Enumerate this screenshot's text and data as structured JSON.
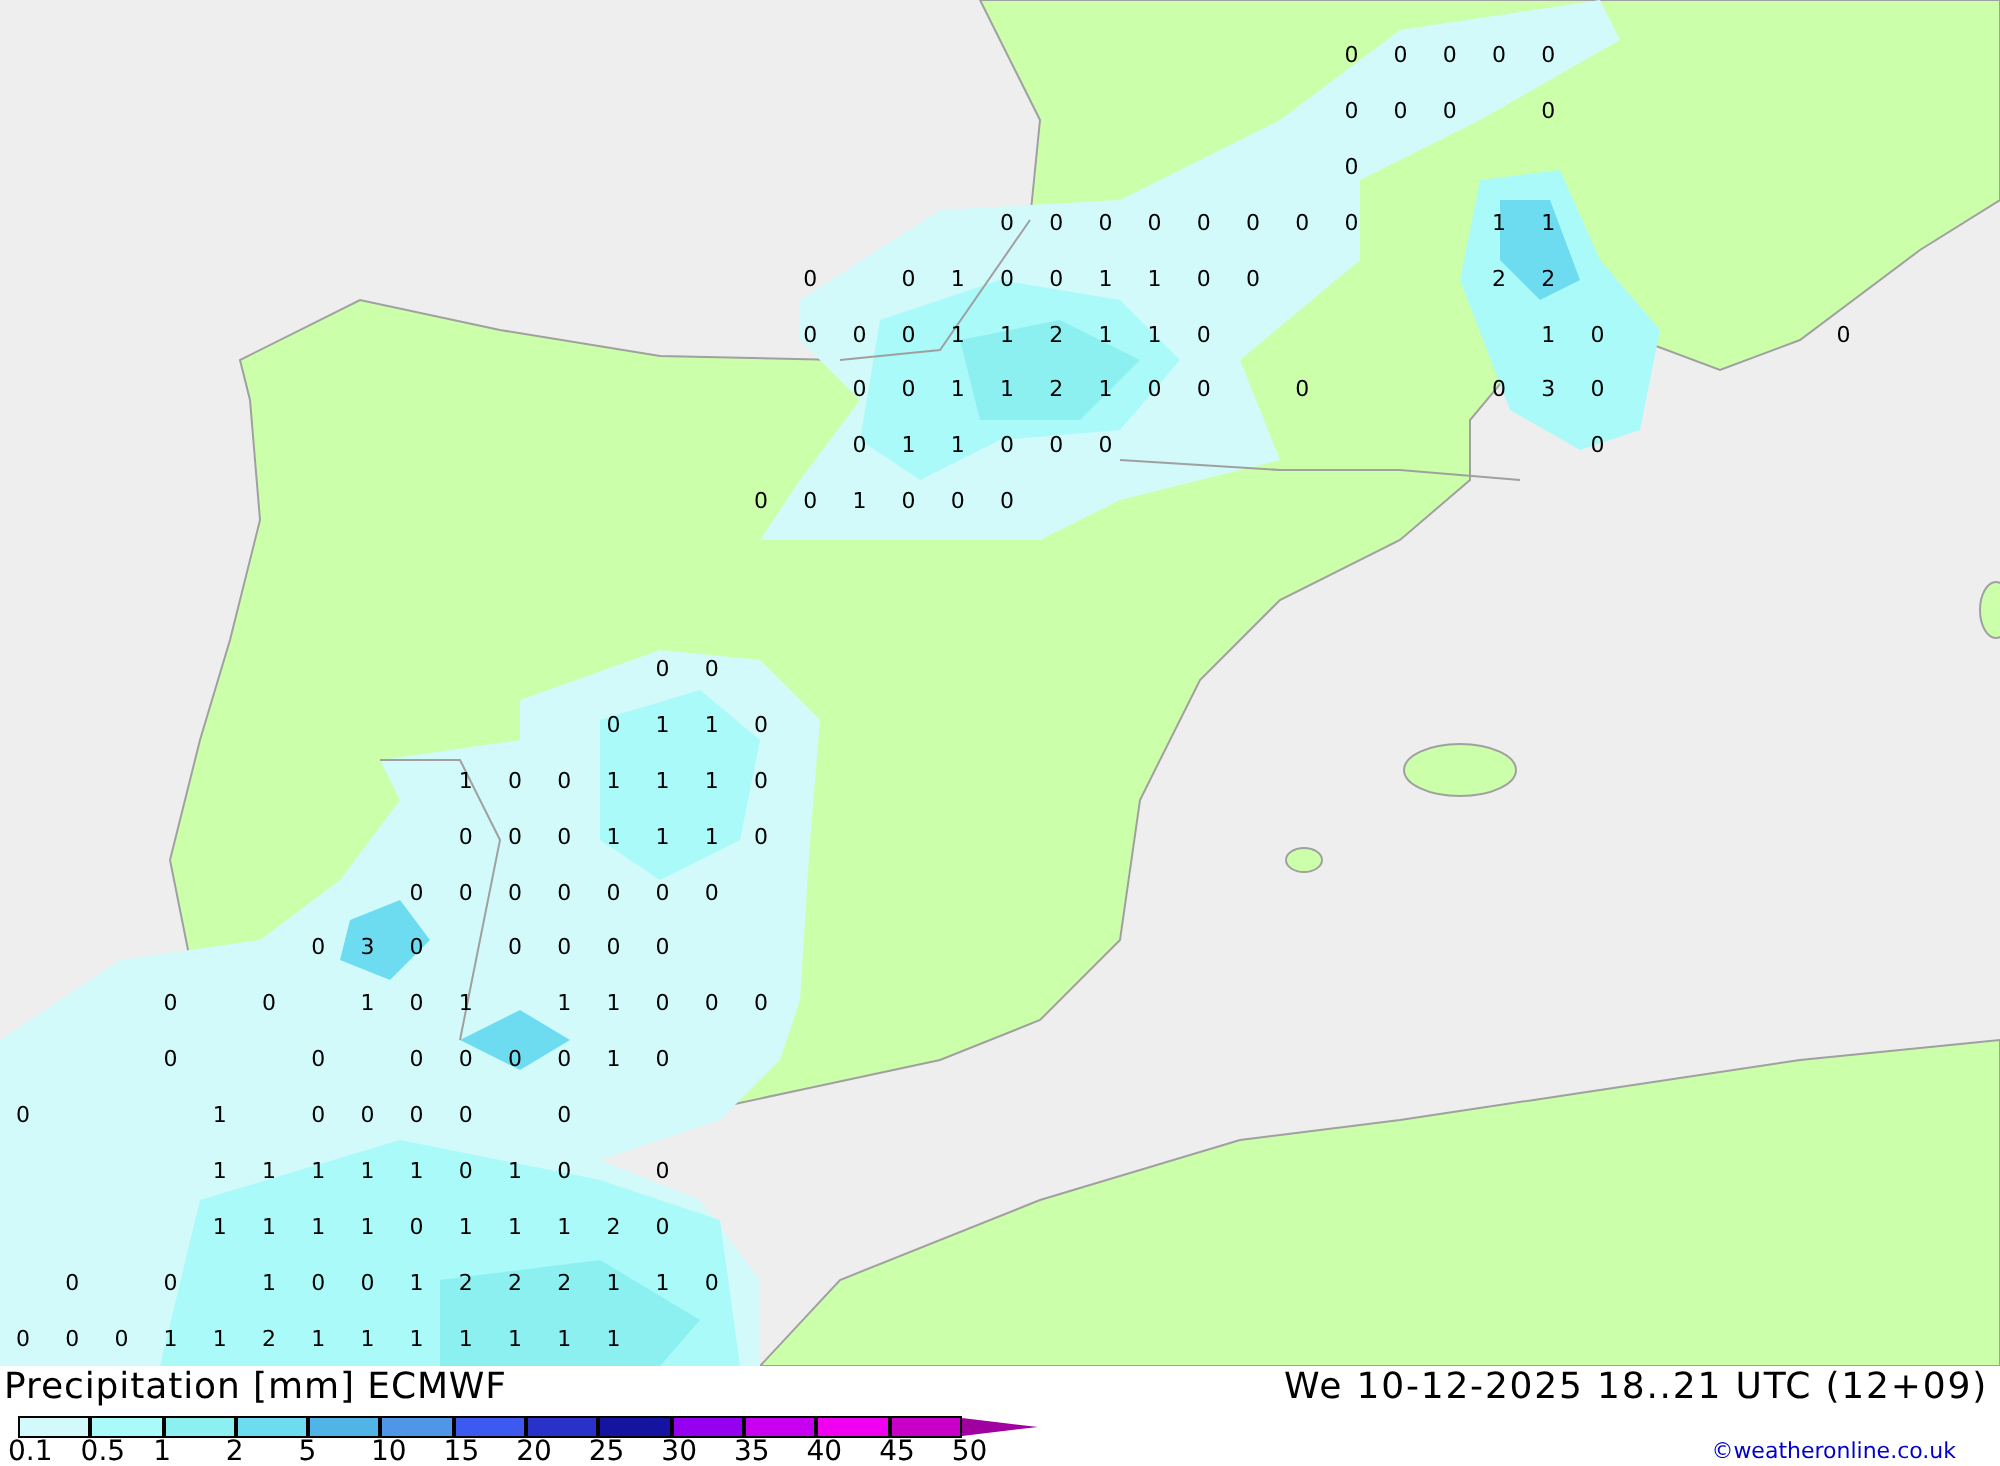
{
  "map": {
    "value_rows": [
      [
        null,
        null,
        null,
        null,
        null,
        null,
        null,
        null,
        null,
        null,
        null,
        null,
        null,
        null,
        null,
        null,
        null,
        null,
        null,
        null,
        null,
        null,
        null,
        null,
        null,
        null,
        null,
        "0",
        "0",
        "0",
        "0",
        "0"
      ],
      [
        null,
        null,
        null,
        null,
        null,
        null,
        null,
        null,
        null,
        null,
        null,
        null,
        null,
        null,
        null,
        null,
        null,
        null,
        null,
        null,
        null,
        null,
        null,
        null,
        null,
        null,
        null,
        "0",
        "0",
        "0",
        null,
        "0"
      ],
      [
        null,
        null,
        null,
        null,
        null,
        null,
        null,
        null,
        null,
        null,
        null,
        null,
        null,
        null,
        null,
        null,
        null,
        null,
        null,
        null,
        null,
        null,
        null,
        null,
        null,
        null,
        null,
        "0"
      ],
      [
        null,
        null,
        null,
        null,
        null,
        null,
        null,
        null,
        null,
        null,
        null,
        null,
        null,
        null,
        null,
        null,
        null,
        null,
        null,
        null,
        "0",
        "0",
        "0",
        "0",
        "0",
        "0",
        "0",
        "0",
        null,
        null,
        "1",
        "1"
      ],
      [
        null,
        null,
        null,
        null,
        null,
        null,
        null,
        null,
        null,
        null,
        null,
        null,
        null,
        null,
        null,
        null,
        "0",
        null,
        "0",
        "1",
        "0",
        "0",
        "1",
        "1",
        "0",
        "0",
        null,
        null,
        null,
        null,
        "2",
        "2"
      ],
      [
        null,
        null,
        null,
        null,
        null,
        null,
        null,
        null,
        null,
        null,
        null,
        null,
        null,
        null,
        null,
        null,
        "0",
        "0",
        "0",
        "1",
        "1",
        "2",
        "1",
        "1",
        "0",
        null,
        null,
        null,
        null,
        null,
        null,
        "1",
        "0",
        null,
        null,
        null,
        null,
        "0"
      ],
      [
        null,
        null,
        null,
        null,
        null,
        null,
        null,
        null,
        null,
        null,
        null,
        null,
        null,
        null,
        null,
        null,
        null,
        "0",
        "0",
        "1",
        "1",
        "2",
        "1",
        "0",
        "0",
        null,
        "0",
        null,
        null,
        null,
        "0",
        "3",
        "0"
      ],
      [
        null,
        null,
        null,
        null,
        null,
        null,
        null,
        null,
        null,
        null,
        null,
        null,
        null,
        null,
        null,
        null,
        null,
        "0",
        "1",
        "1",
        "0",
        "0",
        "0",
        null,
        null,
        null,
        null,
        null,
        null,
        null,
        null,
        null,
        "0"
      ],
      [
        null,
        null,
        null,
        null,
        null,
        null,
        null,
        null,
        null,
        null,
        null,
        null,
        null,
        null,
        null,
        "0",
        "0",
        "1",
        "0",
        "0",
        "0"
      ],
      [],
      [],
      [
        null,
        null,
        null,
        null,
        null,
        null,
        null,
        null,
        null,
        null,
        null,
        null,
        null,
        "0",
        "0"
      ],
      [
        null,
        null,
        null,
        null,
        null,
        null,
        null,
        null,
        null,
        null,
        null,
        null,
        "0",
        "1",
        "1",
        "0"
      ],
      [
        null,
        null,
        null,
        null,
        null,
        null,
        null,
        null,
        null,
        "1",
        "0",
        "0",
        "1",
        "1",
        "1",
        "0"
      ],
      [
        null,
        null,
        null,
        null,
        null,
        null,
        null,
        null,
        null,
        "0",
        "0",
        "0",
        "1",
        "1",
        "1",
        "0"
      ],
      [
        null,
        null,
        null,
        null,
        null,
        null,
        null,
        null,
        "0",
        "0",
        "0",
        "0",
        "0",
        "0",
        "0"
      ],
      [
        null,
        null,
        null,
        null,
        null,
        null,
        "0",
        "3",
        "0",
        null,
        "0",
        "0",
        "0",
        "0"
      ],
      [
        null,
        null,
        null,
        "0",
        null,
        "0",
        null,
        "1",
        "0",
        "1",
        null,
        "1",
        "1",
        "0",
        "0",
        "0"
      ],
      [
        null,
        null,
        null,
        "0",
        null,
        null,
        "0",
        null,
        "0",
        "0",
        "0",
        "0",
        "1",
        "0"
      ],
      [
        "0",
        null,
        null,
        null,
        "1",
        null,
        "0",
        "0",
        "0",
        "0",
        null,
        "0"
      ],
      [
        null,
        null,
        null,
        null,
        "1",
        "1",
        "1",
        "1",
        "1",
        "0",
        "1",
        "0",
        null,
        "0"
      ],
      [
        null,
        null,
        null,
        null,
        "1",
        "1",
        "1",
        "1",
        "0",
        "1",
        "1",
        "1",
        "2",
        "0"
      ],
      [
        null,
        "0",
        null,
        "0",
        null,
        "1",
        "0",
        "0",
        "1",
        "2",
        "2",
        "2",
        "1",
        "1",
        "0"
      ],
      [
        "0",
        "0",
        "0",
        "1",
        "1",
        "2",
        "1",
        "1",
        "1",
        "1",
        "1",
        "1",
        "1"
      ]
    ]
  },
  "legend": {
    "title": "Precipitation [mm] ECMWF",
    "valid_time": "We 10-12-2025 18..21 UTC (12+09)",
    "bins": [
      {
        "color": "#d2fafa"
      },
      {
        "color": "#aafafa"
      },
      {
        "color": "#8cf0f0"
      },
      {
        "color": "#6edcf0"
      },
      {
        "color": "#50b4e6"
      },
      {
        "color": "#5096e6"
      },
      {
        "color": "#3c5af0"
      },
      {
        "color": "#2832c8"
      },
      {
        "color": "#1414a0"
      },
      {
        "color": "#9600f0"
      },
      {
        "color": "#c800f0"
      },
      {
        "color": "#f000f0"
      },
      {
        "color": "#c800c8"
      },
      {
        "color": "#a000a0",
        "kind": "arrow"
      }
    ],
    "ticks": [
      "0.1",
      "0.5",
      "1",
      "2",
      "5",
      "10",
      "15",
      "20",
      "25",
      "30",
      "35",
      "40",
      "45",
      "50"
    ],
    "credit": "©weatheronline.co.uk"
  }
}
